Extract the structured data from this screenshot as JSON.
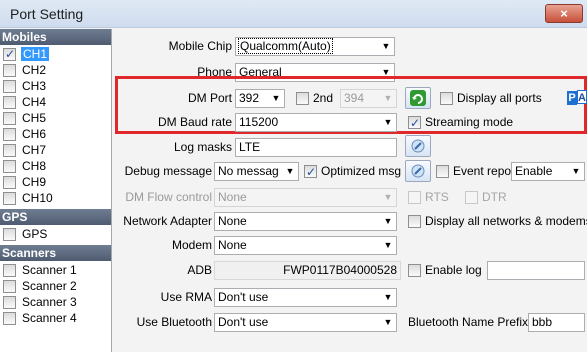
{
  "window": {
    "title": "Port Setting",
    "close_label": "×"
  },
  "left_panel": {
    "groups": [
      {
        "label": "Mobiles",
        "items": [
          {
            "label": "CH1",
            "checked": true,
            "selected": true
          },
          {
            "label": "CH2",
            "checked": false
          },
          {
            "label": "CH3",
            "checked": false
          },
          {
            "label": "CH4",
            "checked": false
          },
          {
            "label": "CH5",
            "checked": false
          },
          {
            "label": "CH6",
            "checked": false
          },
          {
            "label": "CH7",
            "checked": false
          },
          {
            "label": "CH8",
            "checked": false
          },
          {
            "label": "CH9",
            "checked": false
          },
          {
            "label": "CH10",
            "checked": false
          }
        ]
      },
      {
        "label": "GPS",
        "items": [
          {
            "label": "GPS",
            "checked": false
          }
        ]
      },
      {
        "label": "Scanners",
        "items": [
          {
            "label": "Scanner 1",
            "checked": false
          },
          {
            "label": "Scanner 2",
            "checked": false
          },
          {
            "label": "Scanner 3",
            "checked": false
          },
          {
            "label": "Scanner 4",
            "checked": false
          }
        ]
      }
    ]
  },
  "form": {
    "mobile_chip": {
      "label": "Mobile Chip",
      "value": "Qualcomm(Auto)"
    },
    "phone": {
      "label": "Phone",
      "value": "General"
    },
    "dm_port": {
      "label": "DM Port",
      "value": "392"
    },
    "second": {
      "label": "2nd",
      "value": "394",
      "checked": false
    },
    "display_all_ports": {
      "label": "Display all ports",
      "checked": false
    },
    "pa_letters": [
      "P",
      "A"
    ],
    "dm_baud_rate": {
      "label": "DM Baud rate",
      "value": "115200"
    },
    "streaming_mode": {
      "label": "Streaming mode",
      "checked": true
    },
    "log_masks": {
      "label": "Log masks",
      "value": "LTE"
    },
    "debug_message": {
      "label": "Debug message",
      "value": "No messag"
    },
    "optimized_msg": {
      "label": "Optimized msg",
      "checked": true
    },
    "event_reports": {
      "label": "Event reports",
      "value": "Enable"
    },
    "dm_flow_control": {
      "label": "DM Flow control",
      "value": "None"
    },
    "rts": {
      "label": "RTS",
      "checked": false
    },
    "dtr": {
      "label": "DTR",
      "checked": false
    },
    "network_adapter": {
      "label": "Network Adapter",
      "value": "None"
    },
    "display_all_networks": {
      "label": "Display all networks & modems",
      "checked": false
    },
    "modem": {
      "label": "Modem",
      "value": "None"
    },
    "adb": {
      "label": "ADB",
      "value": "FWP0117B04000528"
    },
    "enable_log": {
      "label": "Enable log",
      "checked": false,
      "value": ""
    },
    "use_rma": {
      "label": "Use RMA",
      "value": "Don't use"
    },
    "use_bluetooth": {
      "label": "Use Bluetooth",
      "value": "Don't use"
    },
    "bluetooth_name_prefix": {
      "label": "Bluetooth Name Prefix",
      "value": "bbb"
    }
  },
  "colors": {
    "highlight_box": "#e0282a",
    "group_header": "#5a667b",
    "selection": "#3399ff"
  }
}
